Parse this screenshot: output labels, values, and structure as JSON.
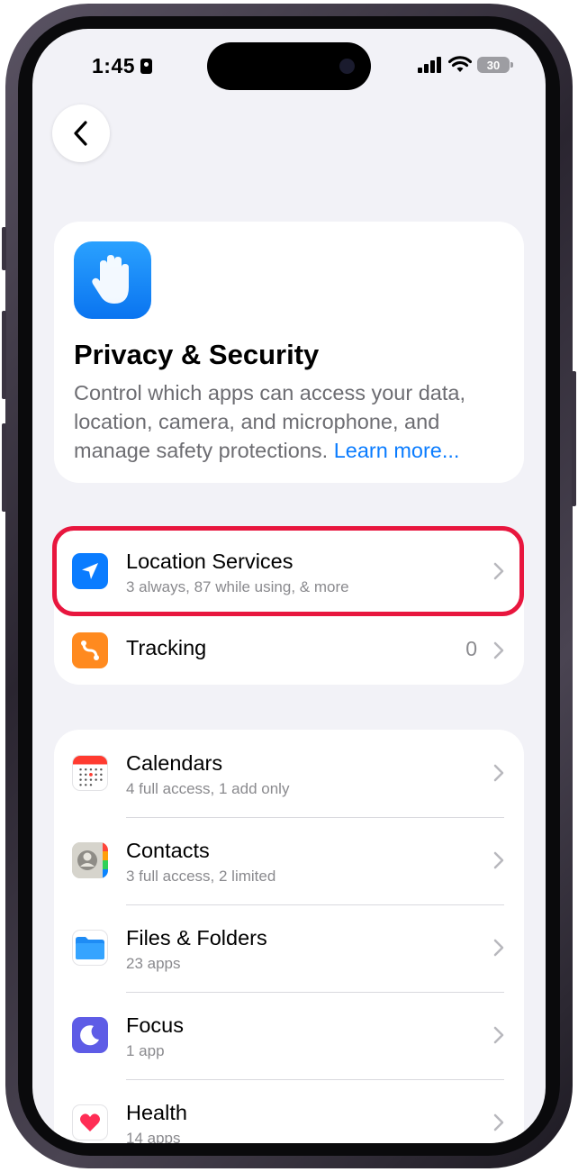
{
  "status_bar": {
    "time": "1:45",
    "battery": "30"
  },
  "nav": {
    "back_icon": "chevron-left-icon"
  },
  "hero": {
    "icon": "raised-hand-icon",
    "title": "Privacy & Security",
    "description": "Control which apps can access your data, location, camera, and microphone, and manage safety protections.",
    "link": "Learn more..."
  },
  "group1": [
    {
      "title": "Location Services",
      "subtitle": "3 always, 87 while using, & more",
      "icon": "location-arrow-icon",
      "highlighted": true
    },
    {
      "title": "Tracking",
      "count": "0",
      "icon": "tracking-icon"
    }
  ],
  "group2": [
    {
      "title": "Calendars",
      "subtitle": "4 full access, 1 add only",
      "icon": "calendar-icon"
    },
    {
      "title": "Contacts",
      "subtitle": "3 full access, 2 limited",
      "icon": "contacts-icon"
    },
    {
      "title": "Files & Folders",
      "subtitle": "23 apps",
      "icon": "folder-icon"
    },
    {
      "title": "Focus",
      "subtitle": "1 app",
      "icon": "moon-icon"
    },
    {
      "title": "Health",
      "subtitle": "14 apps",
      "icon": "heart-icon"
    }
  ],
  "colors": {
    "accent": "#0a7cff",
    "highlight": "#e8163e",
    "background": "#f2f2f7"
  }
}
